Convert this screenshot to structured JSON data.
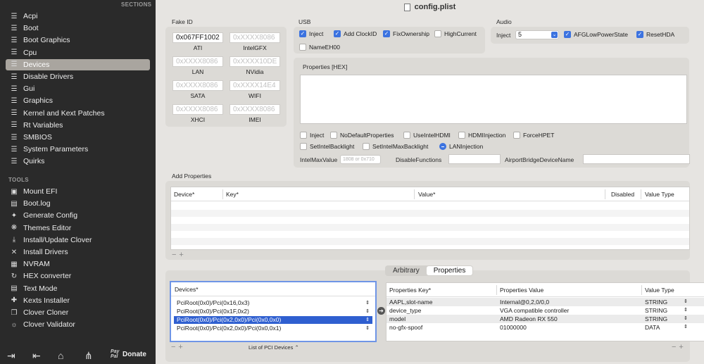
{
  "sidebar": {
    "sections_header": "SECTIONS",
    "sections": [
      {
        "label": "Acpi",
        "icon": "list-icon"
      },
      {
        "label": "Boot",
        "icon": "list-icon"
      },
      {
        "label": "Boot Graphics",
        "icon": "list-icon"
      },
      {
        "label": "Cpu",
        "icon": "list-icon"
      },
      {
        "label": "Devices",
        "icon": "list-icon",
        "active": true
      },
      {
        "label": "Disable Drivers",
        "icon": "list-icon"
      },
      {
        "label": "Gui",
        "icon": "list-icon"
      },
      {
        "label": "Graphics",
        "icon": "list-icon"
      },
      {
        "label": "Kernel and Kext Patches",
        "icon": "list-icon"
      },
      {
        "label": "Rt Variables",
        "icon": "list-icon"
      },
      {
        "label": "SMBIOS",
        "icon": "list-icon"
      },
      {
        "label": "System Parameters",
        "icon": "list-icon"
      },
      {
        "label": "Quirks",
        "icon": "list-icon"
      }
    ],
    "tools_header": "TOOLS",
    "tools": [
      {
        "label": "Mount EFI",
        "icon": "drive-icon"
      },
      {
        "label": "Boot.log",
        "icon": "document-icon"
      },
      {
        "label": "Generate Config",
        "icon": "wand-icon"
      },
      {
        "label": "Themes Editor",
        "icon": "palette-icon"
      },
      {
        "label": "Install/Update Clover",
        "icon": "download-icon"
      },
      {
        "label": "Install Drivers",
        "icon": "tools-icon"
      },
      {
        "label": "NVRAM",
        "icon": "chip-icon"
      },
      {
        "label": "HEX converter",
        "icon": "refresh-icon"
      },
      {
        "label": "Text Mode",
        "icon": "text-icon"
      },
      {
        "label": "Kexts Installer",
        "icon": "puzzle-icon"
      },
      {
        "label": "Clover Cloner",
        "icon": "copy-icon"
      },
      {
        "label": "Clover Validator",
        "icon": "bulb-icon"
      }
    ],
    "bottom": {
      "donate_label": "Donate",
      "paypal_label": "Pay Pal"
    }
  },
  "window": {
    "title": "config.plist"
  },
  "fake_id": {
    "label": "Fake ID",
    "fields": [
      {
        "value": "0x067FF1002",
        "label": "ATI",
        "filled": true
      },
      {
        "value": "0xXXXX8086",
        "label": "IntelGFX"
      },
      {
        "value": "0xXXXX8086",
        "label": "LAN"
      },
      {
        "value": "0xXXXX10DE",
        "label": "NVidia"
      },
      {
        "value": "0xXXXX8086",
        "label": "SATA"
      },
      {
        "value": "0xXXXX14E4",
        "label": "WIFI"
      },
      {
        "value": "0xXXXX8086",
        "label": "XHCI"
      },
      {
        "value": "0xXXXX8086",
        "label": "IMEI"
      }
    ]
  },
  "usb": {
    "label": "USB",
    "options": [
      {
        "label": "Inject",
        "checked": true
      },
      {
        "label": "Add ClockID",
        "checked": true
      },
      {
        "label": "FixOwnership",
        "checked": true
      },
      {
        "label": "HighCurrent",
        "checked": false
      },
      {
        "label": "NameEH00",
        "checked": false
      }
    ]
  },
  "audio": {
    "label": "Audio",
    "inject_label": "Inject",
    "inject_value": "5",
    "options": [
      {
        "label": "AFGLowPowerState",
        "checked": true
      },
      {
        "label": "ResetHDA",
        "checked": true
      }
    ]
  },
  "properties_hex": {
    "label": "Properties [HEX]",
    "options": [
      {
        "label": "Inject",
        "checked": false
      },
      {
        "label": "NoDefaultProperties",
        "checked": false
      },
      {
        "label": "UseIntelHDMI",
        "checked": false
      },
      {
        "label": "HDMIInjection",
        "checked": false
      },
      {
        "label": "ForceHPET",
        "checked": false
      },
      {
        "label": "SetIntelBacklight",
        "checked": false
      },
      {
        "label": "SetIntelMaxBacklight",
        "checked": false
      },
      {
        "label": "LANInjection",
        "checked": true
      }
    ],
    "intel_max_value_label": "IntelMaxValue",
    "intel_max_value_placeholder": "1808 or 0x710",
    "disable_functions_label": "DisableFunctions",
    "airport_label": "AirportBridgeDeviceName"
  },
  "add_properties": {
    "label": "Add Properties",
    "columns": [
      "Device*",
      "Key*",
      "Value*",
      "Disabled",
      "Value Type"
    ]
  },
  "tabs": [
    {
      "label": "Arbitrary",
      "selected": false
    },
    {
      "label": "Properties",
      "selected": true
    }
  ],
  "devices": {
    "header": "Devices*",
    "rows": [
      {
        "label": "PciRoot(0x0)/Pci(0x16,0x3)",
        "selected": false
      },
      {
        "label": "PciRoot(0x0)/Pci(0x1F,0x2)",
        "selected": false
      },
      {
        "label": "PciRoot(0x0)/Pci(0x2,0x0)/Pci(0x0,0x0)",
        "selected": true
      },
      {
        "label": "PciRoot(0x0)/Pci(0x2,0x0)/Pci(0x0,0x1)",
        "selected": false
      }
    ],
    "list_label": "List of PCI Devices"
  },
  "properties_table": {
    "columns": [
      "Properties Key*",
      "Properties Value",
      "Value Type"
    ],
    "rows": [
      {
        "key": "AAPL,slot-name",
        "value": "Internal@0,2,0/0,0",
        "type": "STRING"
      },
      {
        "key": "device_type",
        "value": "VGA compatible controller",
        "type": "STRING"
      },
      {
        "key": "model",
        "value": "AMD Radeon RX 550",
        "type": "STRING"
      },
      {
        "key": "no-gfx-spoof",
        "value": "01000000",
        "type": "DATA"
      }
    ]
  },
  "colors": {
    "accent": "#3c73e0",
    "sidebar_bg": "#2a2a2a",
    "selection": "#2f5fd0"
  }
}
